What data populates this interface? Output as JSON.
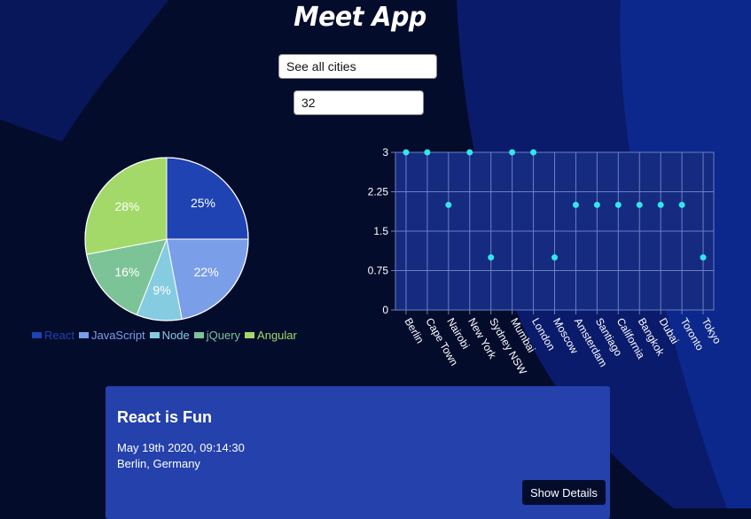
{
  "header": {
    "title": "Meet App"
  },
  "search": {
    "city_value": "See all cities",
    "number_value": "32"
  },
  "pie": {
    "chart_data": {
      "type": "pie",
      "labels": [
        "React",
        "JavaScript",
        "Node",
        "jQuery",
        "Angular"
      ],
      "values": [
        25,
        22,
        9,
        16,
        28
      ],
      "colors": [
        "#1f43b3",
        "#7b9ee8",
        "#85cce0",
        "#7cc497",
        "#a2d968"
      ],
      "legend": "bottom"
    }
  },
  "scatter": {
    "chart_data": {
      "type": "scatter",
      "categories": [
        "Berlin",
        "Cape Town",
        "Nairobi",
        "New York",
        "Sydney NSW",
        "Mumbai",
        "London",
        "Moscow",
        "Amsterdam",
        "Santiago",
        "California",
        "Bangkok",
        "Dubai",
        "Toronto",
        "Tokyo"
      ],
      "values": [
        3,
        3,
        2,
        3,
        1,
        3,
        3,
        1,
        2,
        2,
        2,
        2,
        2,
        2,
        1
      ],
      "yticks": [
        "0",
        "0.75",
        "1.5",
        "2.25",
        "3"
      ],
      "ylim": [
        0,
        3
      ],
      "point_color": "#33e6ee",
      "grid": true
    }
  },
  "event": {
    "title": "React is Fun",
    "date": "May 19th 2020, 09:14:30",
    "location": "Berlin, Germany",
    "button_label": "Show Details"
  }
}
